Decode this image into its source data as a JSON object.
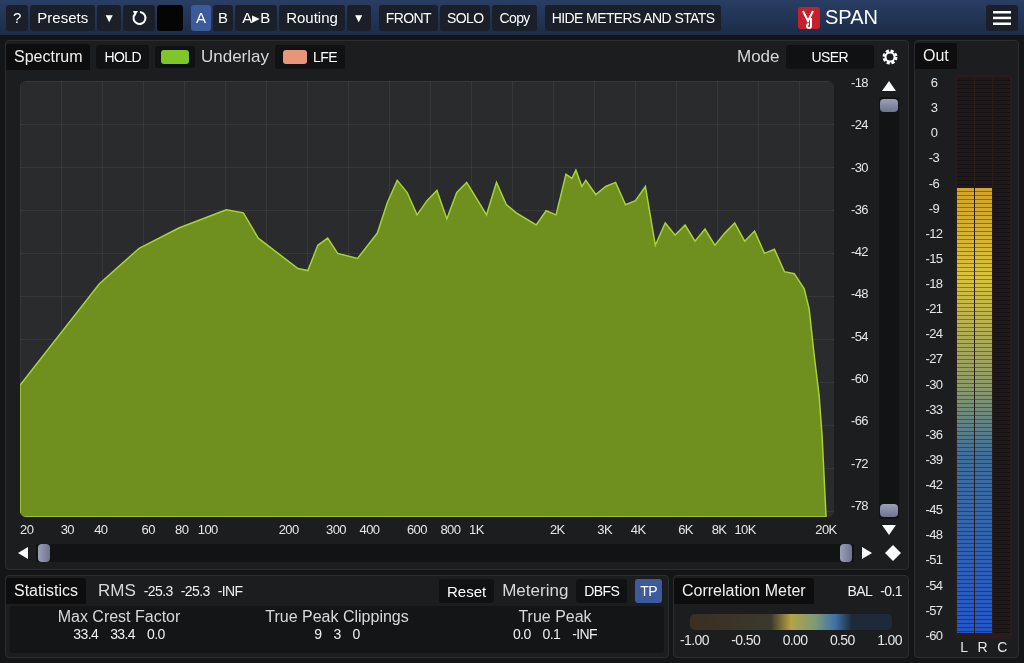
{
  "toolbar": {
    "help": "?",
    "presets": "Presets",
    "presets_caret": "▼",
    "ab_slots": [
      {
        "label": "A",
        "selected": true
      },
      {
        "label": "B",
        "selected": false
      }
    ],
    "ab_copy": "A▸B",
    "routing": "Routing",
    "routing_caret": "▼",
    "buttons": [
      "FRONT",
      "SOLO",
      "Copy"
    ],
    "hide": "HIDE METERS AND STATS"
  },
  "brand": {
    "name": "SPAN"
  },
  "spectrum": {
    "tab": "Spectrum",
    "hold": {
      "label": "HOLD",
      "on": false
    },
    "underlay_label": "Underlay",
    "underlay": "LFE",
    "mode_label": "Mode",
    "mode": "USER",
    "y_ticks": [
      "-18",
      "-24",
      "-30",
      "-36",
      "-42",
      "-48",
      "-54",
      "-60",
      "-66",
      "-72",
      "-78"
    ],
    "x_ticks": [
      "20",
      "30",
      "40",
      "60",
      "80",
      "100",
      "200",
      "300",
      "400",
      "600",
      "800",
      "1K",
      "2K",
      "3K",
      "4K",
      "6K",
      "8K",
      "10K",
      "20K"
    ]
  },
  "statistics": {
    "tab": "Statistics",
    "rms_label": "RMS",
    "rms": [
      "-25.3",
      "-25.3",
      "-INF"
    ],
    "reset": "Reset",
    "metering_label": "Metering",
    "metering": "DBFS",
    "tp": {
      "label": "TP",
      "selected": true
    },
    "groups": [
      {
        "title": "Max Crest Factor",
        "values": [
          "33.4",
          "33.4",
          "0.0"
        ]
      },
      {
        "title": "True Peak Clippings",
        "values": [
          "9",
          "3",
          "0"
        ]
      },
      {
        "title": "True Peak",
        "values": [
          "0.0",
          "0.1",
          "-INF"
        ]
      }
    ]
  },
  "correlation": {
    "title": "Correlation Meter",
    "bal_label": "BAL",
    "bal": "-0.1",
    "ticks": [
      "-1.00",
      "-0.50",
      "0.00",
      "0.50",
      "1.00"
    ]
  },
  "out": {
    "tab": "Out",
    "scale": [
      "6",
      "3",
      "0",
      "-3",
      "-6",
      "-9",
      "-12",
      "-15",
      "-18",
      "-21",
      "-24",
      "-27",
      "-30",
      "-33",
      "-36",
      "-39",
      "-42",
      "-45",
      "-48",
      "-51",
      "-54",
      "-57",
      "-60"
    ],
    "channels": [
      {
        "name": "L",
        "level": 0.8
      },
      {
        "name": "R",
        "level": 0.8
      },
      {
        "name": "C"
      }
    ]
  }
}
